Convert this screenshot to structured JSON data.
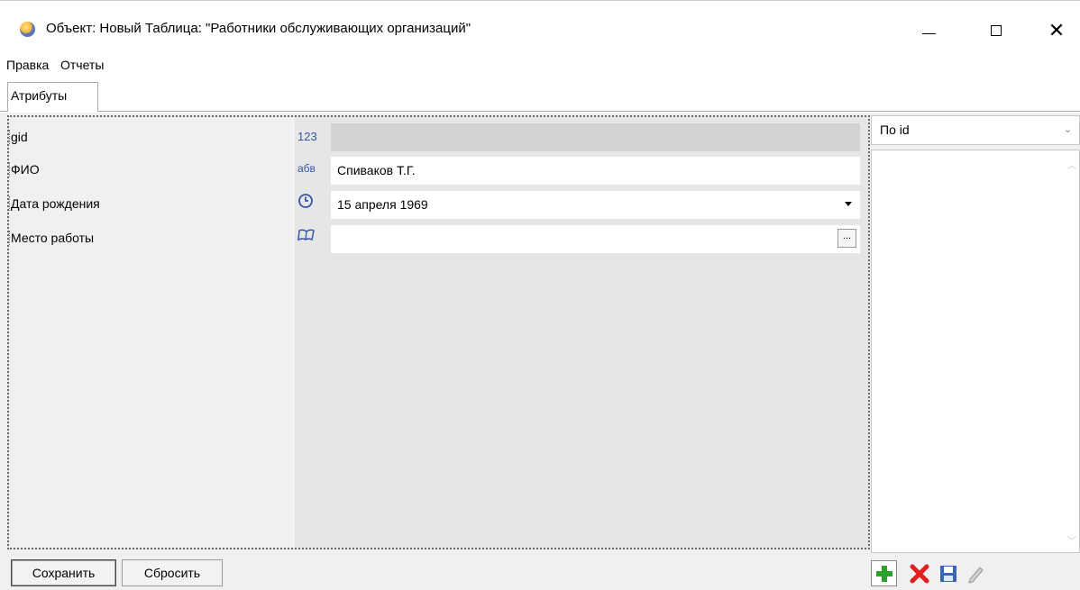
{
  "window": {
    "title": "Объект: Новый Таблица: \"Работники обслуживающих организаций\"",
    "controls": {
      "minimize": "minimize-icon",
      "maximize": "maximize-icon",
      "close": "✕"
    }
  },
  "menu": {
    "items": [
      {
        "label": "Правка"
      },
      {
        "label": "Отчеты"
      }
    ]
  },
  "tabs": [
    {
      "label": "Атрибуты",
      "selected": true
    }
  ],
  "attributes": {
    "rows": [
      {
        "label": "gid",
        "type_icon": "123",
        "value": "",
        "disabled": true
      },
      {
        "label": "ФИО",
        "type_icon": "абв",
        "value": "Спиваков Т.Г."
      },
      {
        "label": "Дата рождения",
        "type_icon": "clock-icon",
        "value": "15 апреля 1969"
      },
      {
        "label": "Место работы",
        "type_icon": "book-icon",
        "value": "",
        "button": "..."
      }
    ]
  },
  "right_panel": {
    "sort_select": "По id",
    "list_items": []
  },
  "buttons": {
    "save": "Сохранить",
    "reset": "Сбросить"
  },
  "toolbar": {
    "icons": [
      "add-icon",
      "delete-icon",
      "save-icon",
      "edit-icon"
    ]
  },
  "colors": {
    "accent": "#3355aa",
    "add_green": "#2aa12a",
    "delete_red": "#e02020",
    "save_blue": "#3a66b5"
  }
}
